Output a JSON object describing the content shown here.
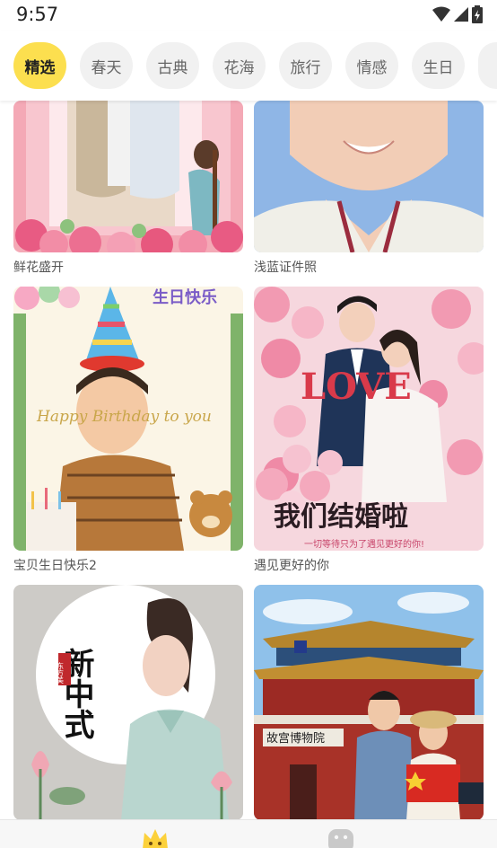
{
  "status_bar": {
    "time": "9:57"
  },
  "categories": [
    {
      "label": "精选",
      "active": true
    },
    {
      "label": "春天",
      "active": false
    },
    {
      "label": "古典",
      "active": false
    },
    {
      "label": "花海",
      "active": false
    },
    {
      "label": "旅行",
      "active": false
    },
    {
      "label": "情感",
      "active": false
    },
    {
      "label": "生日",
      "active": false
    },
    {
      "label": "",
      "active": false
    }
  ],
  "templates": [
    {
      "title": "鲜花盛开"
    },
    {
      "title": "浅蓝证件照"
    },
    {
      "title": "宝贝生日快乐2",
      "overlay": {
        "top_text": "生日快乐",
        "greeting": "Happy Birthday to you"
      }
    },
    {
      "title": "遇见更好的你",
      "overlay": {
        "love_text": "LOVE",
        "headline": "我们结婚啦",
        "subline": "一切等待只为了遇见更好的你!"
      }
    },
    {
      "title": "",
      "overlay": {
        "vertical_text": "新中式",
        "seal_text": "东方美"
      }
    },
    {
      "title": "",
      "overlay": {
        "plaque_text": "故宫博物院"
      }
    }
  ],
  "bottom_nav": {
    "icons": [
      "crown-icon",
      "smiley-icon"
    ]
  },
  "colors": {
    "accent": "#fcdf4f",
    "chip_bg": "#f1f1f1"
  }
}
